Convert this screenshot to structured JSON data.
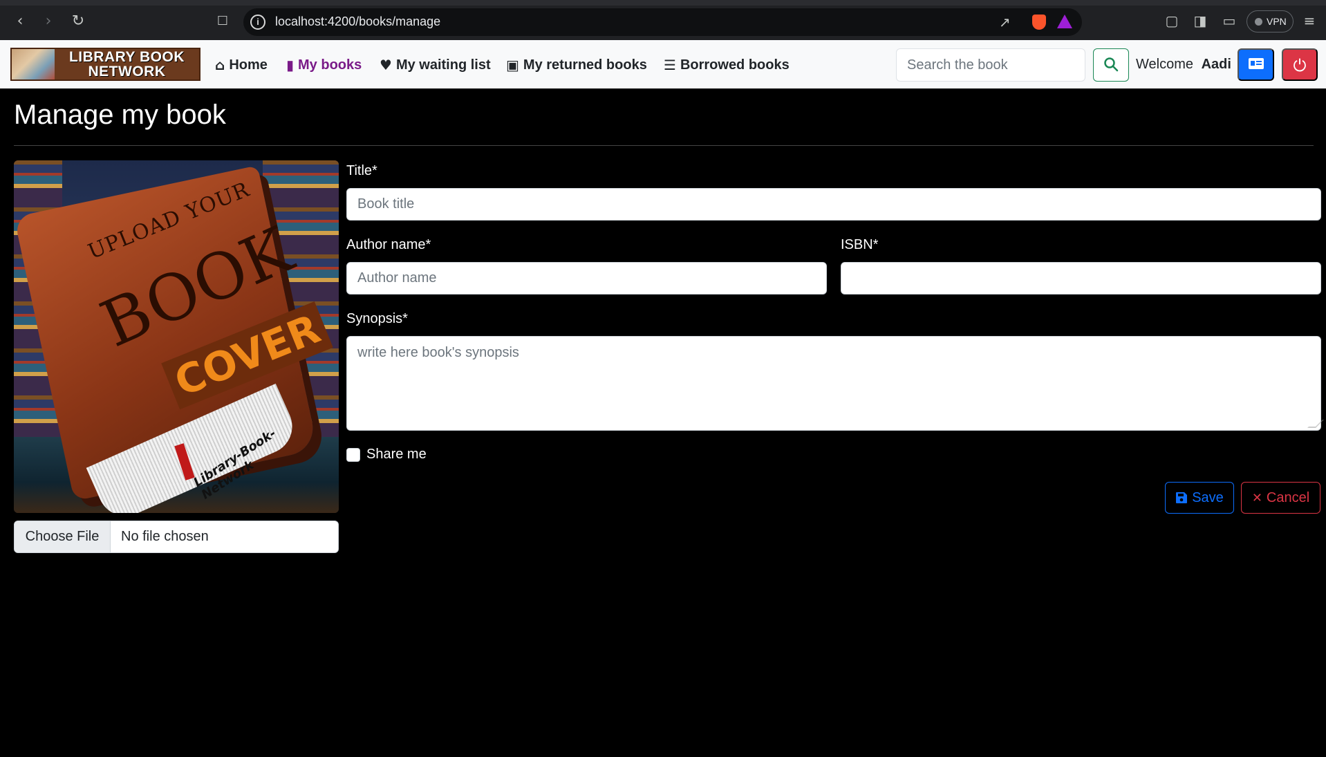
{
  "browser": {
    "url": "localhost:4200/books/manage",
    "vpn_label": "VPN"
  },
  "navbar": {
    "logo_text_line1": "LIBRARY BOOK",
    "logo_text_line2": "NETWORK",
    "links": [
      {
        "label": "Home",
        "icon": "house-icon",
        "active": false
      },
      {
        "label": "My books",
        "icon": "book-icon",
        "active": true
      },
      {
        "label": "My waiting list",
        "icon": "heart-icon",
        "active": false
      },
      {
        "label": "My returned books",
        "icon": "truck-icon",
        "active": false
      },
      {
        "label": "Borrowed books",
        "icon": "list-check-icon",
        "active": false
      }
    ],
    "search_placeholder": "Search the book",
    "welcome_text": "Welcome",
    "username": "Aadi",
    "active_color": "#7a1a88"
  },
  "page": {
    "title": "Manage my book"
  },
  "cover": {
    "line1": "UPLOAD YOUR",
    "line2": "BOOK",
    "line3": "COVER",
    "line4": "Library-Book-Network"
  },
  "file_input": {
    "button_label": "Choose File",
    "status": "No file chosen"
  },
  "form": {
    "title_label": "Title*",
    "title_placeholder": "Book title",
    "author_label": "Author name*",
    "author_placeholder": "Author name",
    "isbn_label": "ISBN*",
    "isbn_placeholder": "",
    "synopsis_label": "Synopsis*",
    "synopsis_placeholder": "write here book's synopsis",
    "share_label": "Share me",
    "share_checked": false
  },
  "actions": {
    "save_label": "Save",
    "cancel_label": "Cancel"
  }
}
